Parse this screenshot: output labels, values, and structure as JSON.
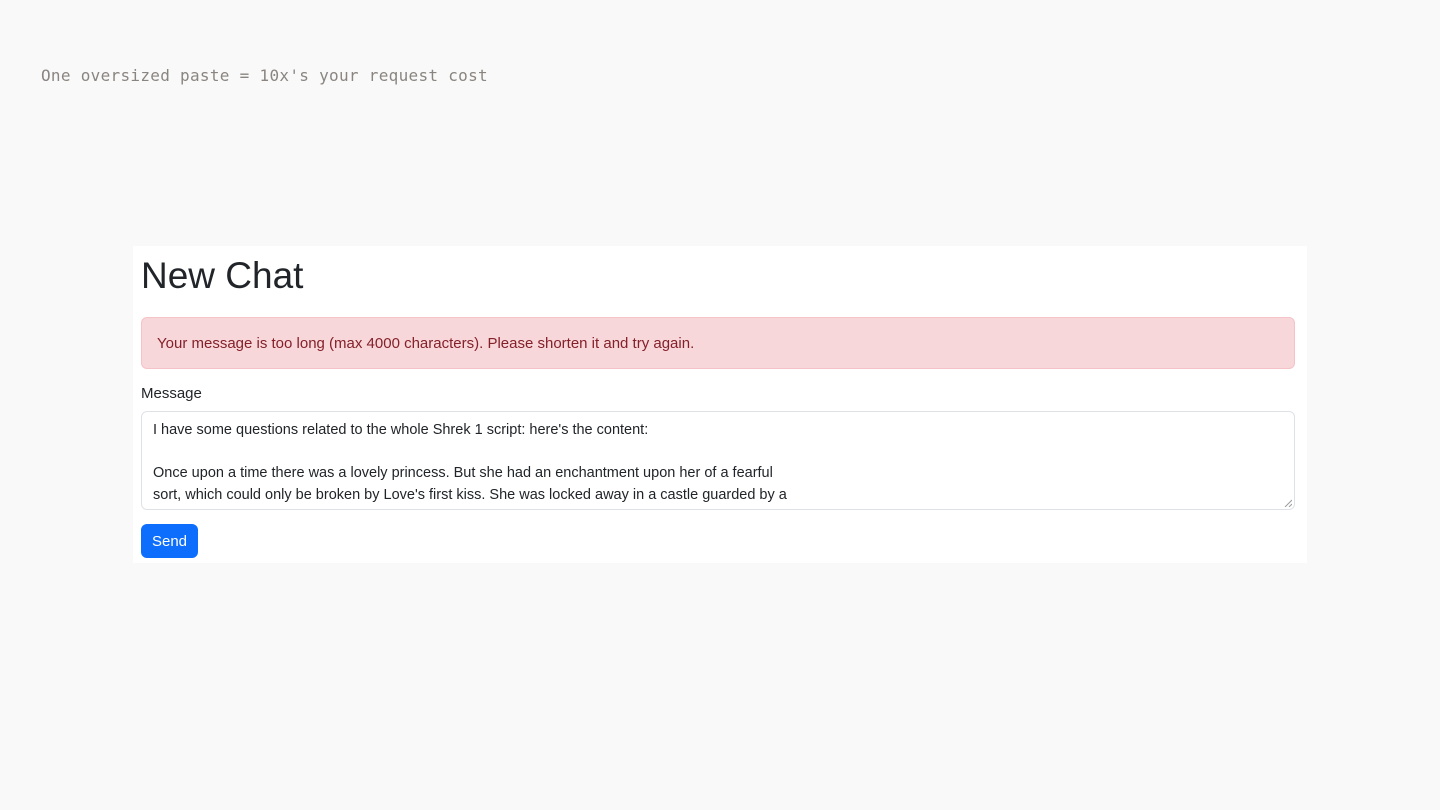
{
  "caption": "One oversized paste = 10x's your request cost",
  "page": {
    "title": "New Chat",
    "alert": {
      "message": "Your message is too long (max 4000 characters). Please shorten it and try again.",
      "color": "#842029",
      "background": "#f8d7da"
    },
    "message_label": "Message",
    "message_value": {
      "line1": "I have some questions related to the whole Shrek 1 script: here's the content:",
      "line2": "",
      "line3": "Once upon a time there was a lovely princess. But she had an enchantment upon her of a fearful",
      "line4": "sort, which could only be broken by Love's first kiss. She was locked away in a castle guarded by a"
    },
    "send_label": "Send",
    "accent": "#0d6efd"
  }
}
